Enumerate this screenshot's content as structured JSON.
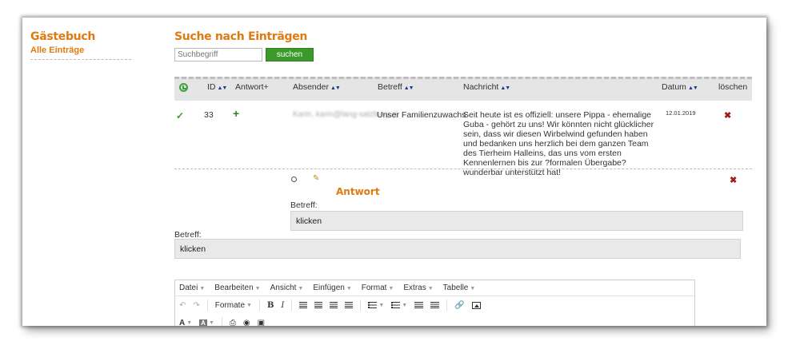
{
  "sidebar": {
    "title": "Gästebuch",
    "link": "Alle Einträge"
  },
  "search": {
    "title": "Suche nach Einträgen",
    "placeholder": "Suchbegriff",
    "button": "suchen"
  },
  "table": {
    "headers": {
      "id": "ID",
      "antwort": "Antwort+",
      "absender": "Absender",
      "betreff": "Betreff",
      "nachricht": "Nachricht",
      "datum": "Datum",
      "loeschen": "löschen"
    },
    "sort_glyph": "▲▼",
    "rows": [
      {
        "status_glyph": "✓",
        "id": "33",
        "answer_glyph": "+",
        "sender": "Karin, karin@lang-salzburg.at",
        "subject": "Unser Familienzuwachs",
        "message": "Seit heute ist es offiziell: unsere Pippa - ehemalige Guba - gehört zu uns! Wir könnten nicht glücklicher sein, dass wir diesen Wirbelwind gefunden haben und bedanken uns herzlich bei dem ganzen Team des Tierheim Halleins, das uns vom ersten Kennenlernen bis zur ?formalen Übergabe? wunderbar unterstützt hat!",
        "date": "12.01.2019",
        "delete_glyph": "✖"
      }
    ]
  },
  "reply": {
    "title": "Antwort",
    "delete_glyph": "✖",
    "pencil_glyph": "✎",
    "inner_label": "Betreff:",
    "inner_value": "klicken",
    "outer_label": "Betreff:",
    "outer_value": "klicken"
  },
  "editor": {
    "menu": [
      "Datei",
      "Bearbeiten",
      "Ansicht",
      "Einfügen",
      "Format",
      "Extras",
      "Tabelle"
    ],
    "formats_label": "Formate",
    "undo_glyph": "↶",
    "redo_glyph": "↷",
    "bold_glyph": "B",
    "italic_glyph": "I",
    "text_color_glyph": "A",
    "bg_color_glyph": "A",
    "print_glyph": "⎙",
    "preview_glyph": "◉",
    "media_glyph": "▣",
    "link_glyph": "🔗"
  },
  "colors": {
    "accent_orange": "#e07a10",
    "button_green": "#3c9a2a",
    "delete_red": "#a51d1d"
  }
}
